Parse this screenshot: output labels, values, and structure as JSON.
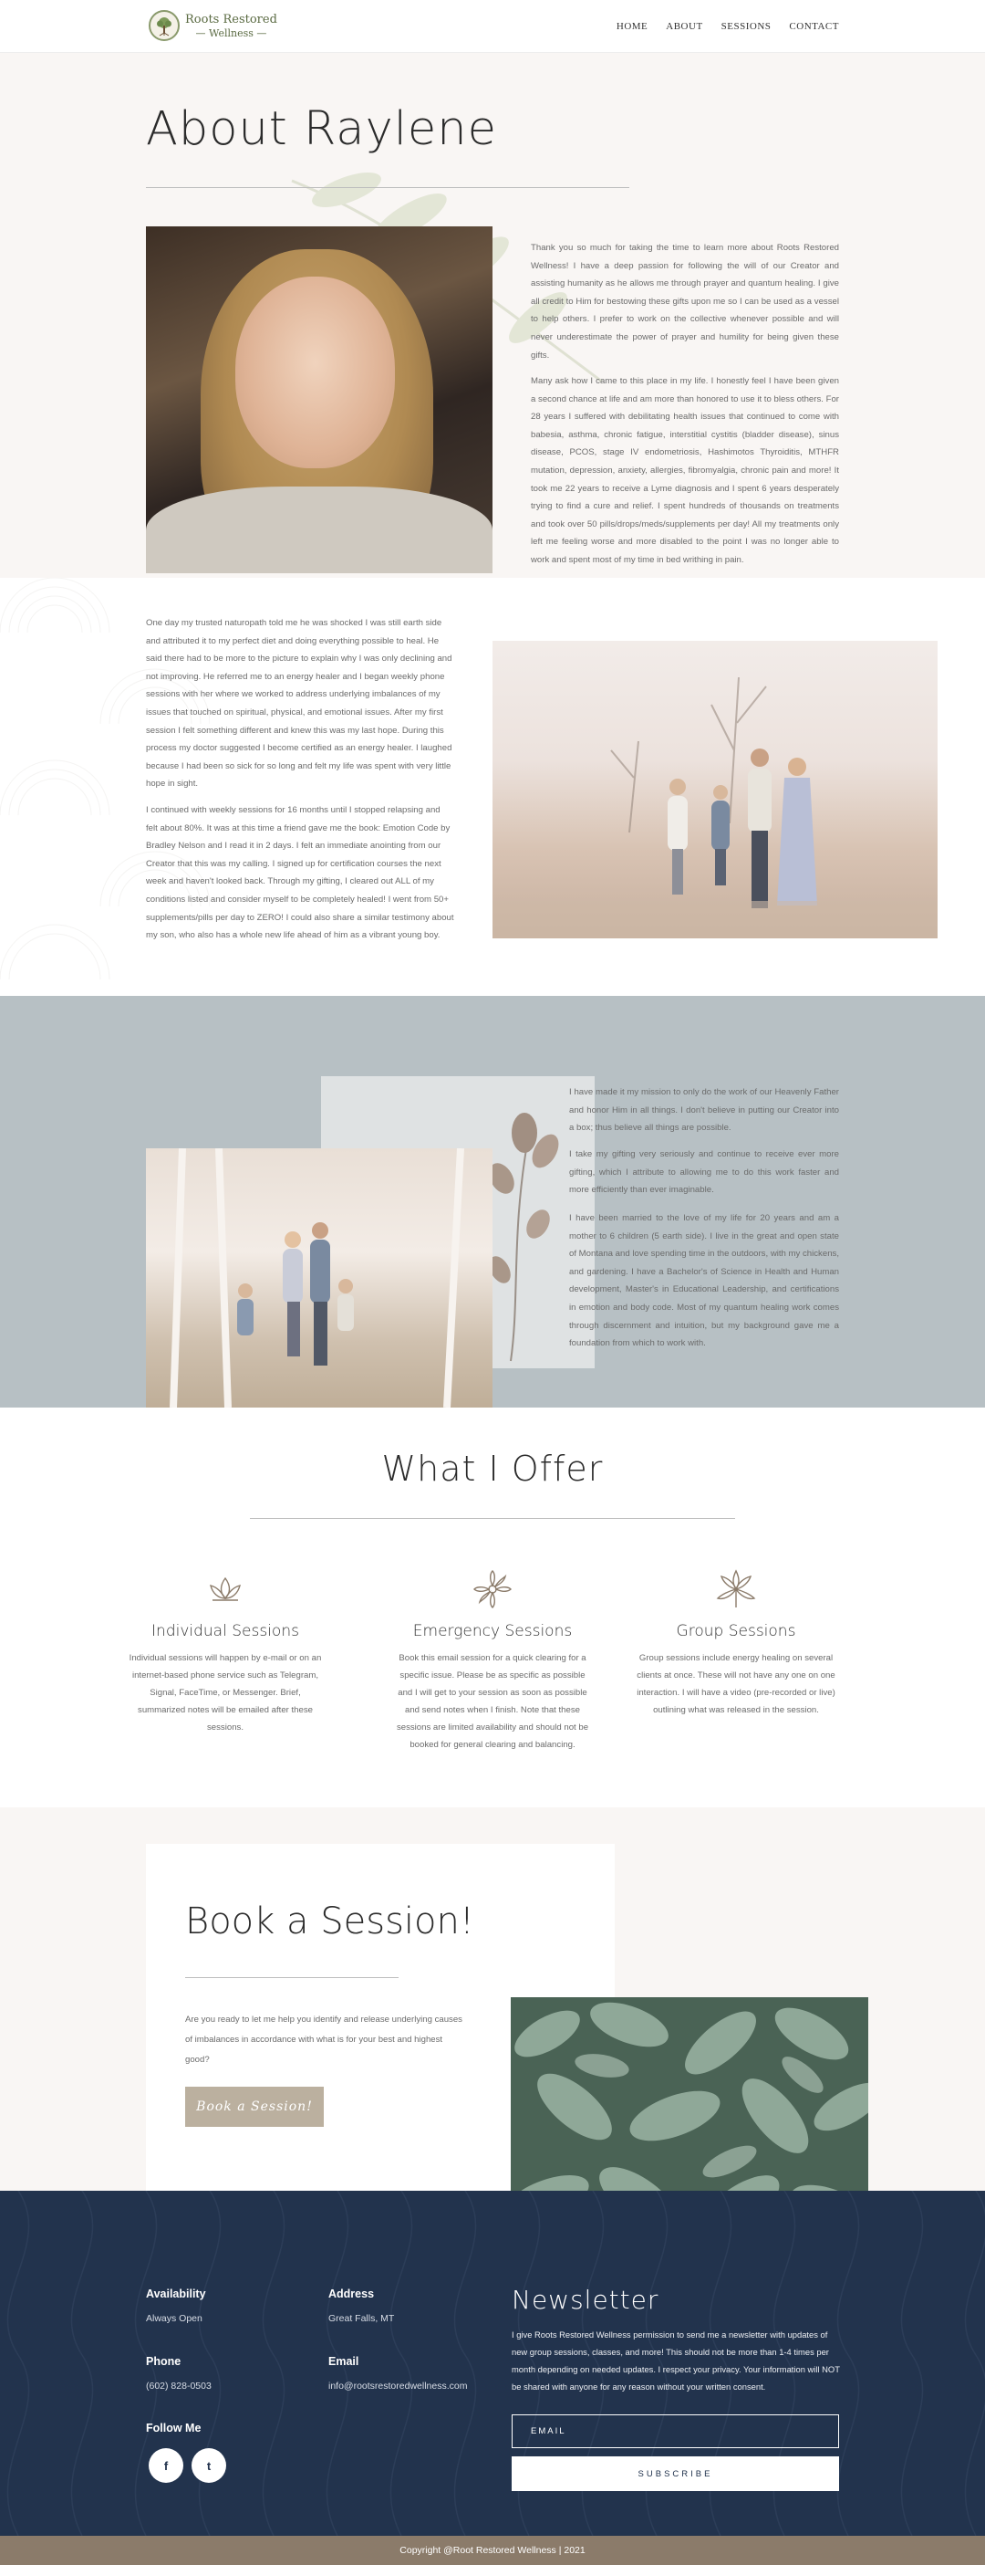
{
  "nav": {
    "logo_line1": "Roots Restored",
    "logo_line2": "Wellness",
    "links": [
      "HOME",
      "ABOUT",
      "SESSIONS",
      "CONTACT"
    ]
  },
  "about": {
    "title": "About Raylene",
    "p1": "Thank you so much for taking the time to learn more about Roots Restored Wellness! I have a deep passion for following the will of our Creator and assisting humanity as he allows me through prayer and quantum healing. I give all credit to Him for bestowing these gifts upon me so I can be used as a vessel to help others. I prefer to work on the collective whenever possible and will never underestimate the power of prayer and humility for being given these gifts.",
    "p2": "Many ask how I came to this place in my life. I honestly feel I have been given a second chance at life and am more than honored to use it to bless others. For 28 years I suffered with debilitating health issues that continued to come with babesia, asthma, chronic fatigue, interstitial cystitis (bladder disease), sinus disease, PCOS, stage IV endometriosis, Hashimotos Thyroiditis, MTHFR mutation, depression, anxiety, allergies, fibromyalgia, chronic pain and more! It took me 22 years to receive a Lyme diagnosis and I spent 6 years desperately trying to find a cure and relief. I spent hundreds of thousands on treatments and took over 50 pills/drops/meds/supplements per day! All my treatments only left me feeling worse and more disabled to the point I was no longer able to work and spent most of my time in bed writhing in pain."
  },
  "story": {
    "p1": "One day my trusted naturopath told me he was shocked I was still earth side and attributed it to my perfect diet and doing everything possible to heal. He said there had to be more to the picture to explain why I was only declining and not improving. He referred me to an energy healer and I began weekly phone sessions with her where we worked to address underlying imbalances of my issues that touched on spiritual, physical, and emotional issues. After my first session I felt something different and knew this was my last hope. During this process my doctor suggested I become certified as an energy healer. I laughed because I had been so sick for so long and felt my life was spent with very little hope in sight.",
    "p2": " I continued with weekly sessions for 16 months until I stopped relapsing and felt about 80%. It was at this time a friend gave me the book: Emotion Code by Bradley Nelson and I read it in 2 days. I felt an immediate anointing from our Creator that this was my calling. I signed up for certification courses the next week and haven't looked back. Through my gifting, I cleared out ALL of my conditions listed and consider myself to be completely healed! I went from 50+ supplements/pills per day to ZERO! I could also share a similar testimony about my son, who also has a whole new life ahead of him as a vibrant young boy."
  },
  "mission": {
    "p1": "I have made it my mission to only do the work of our Heavenly Father and honor Him in all things. I don't believe in putting our Creator into a box; thus believe all things are possible.",
    "p2": "I take my gifting very seriously and continue to receive ever more gifting, which I attribute to allowing me to do this work faster and more efficiently than ever imaginable.",
    "p3": "I have been married to the love of my life for 20 years and am a mother to 6 children (5 earth side). I live in the great and open state of Montana and love spending time in the outdoors, with my chickens, and gardening. I have a Bachelor's of Science in Health and Human development, Master's in Educational Leadership, and certifications in emotion and body code. Most of my quantum healing work comes through discernment and intuition, but my background gave me a foundation from which to work with."
  },
  "offer": {
    "title": "What I Offer",
    "services": [
      {
        "icon": "lotus-icon",
        "title": "Individual Sessions",
        "text": "Individual sessions will happen by e-mail or on an internet-based phone service such as Telegram, Signal, FaceTime, or Messenger. Brief, summarized notes will be emailed after these sessions."
      },
      {
        "icon": "flower-icon",
        "title": "Emergency Sessions",
        "text": "Book this email session for a quick clearing for a specific issue. Please be as specific as possible and I will get to your session as soon as possible and send notes when I finish. Note that these sessions are limited availability and should not be booked for general clearing and balancing."
      },
      {
        "icon": "star-flower-icon",
        "title": "Group Sessions",
        "text": "Group sessions include energy healing on several clients at once. These will not have any one on one interaction. I will have a video (pre-recorded or live) outlining what was released in the session."
      }
    ]
  },
  "book": {
    "title": "Book a Session!",
    "text": "Are you ready to let me help you identify and release underlying causes of imbalances in accordance with what is for your best and highest good?",
    "button": "Book a Session!"
  },
  "footer": {
    "availability_label": "Availability",
    "availability_value": "Always Open",
    "address_label": "Address",
    "address_value": "Great Falls, MT",
    "phone_label": "Phone",
    "phone_value": "(602) 828-0503",
    "email_label": "Email",
    "email_value": "info@rootsrestoredwellness.com",
    "follow_label": "Follow Me",
    "social": [
      "f",
      "t"
    ],
    "newsletter_title": "Newsletter",
    "newsletter_text": "I give Roots Restored Wellness permission to send me a newsletter with updates of new group sessions, classes, and more! This should not be more than 1-4 times per month depending on needed updates. I respect your privacy. Your information will NOT be shared with anyone for any reason without your written consent.",
    "email_placeholder": "EMAIL",
    "subscribe": "SUBSCRIBE",
    "copyright": "Copyright @Root Restored Wellness | 2021"
  },
  "colors": {
    "accent": "#bbb09f",
    "footer_bg": "#22334d",
    "mission_bg": "#b7c0c4",
    "copyright_bg": "#8b7b6a"
  }
}
